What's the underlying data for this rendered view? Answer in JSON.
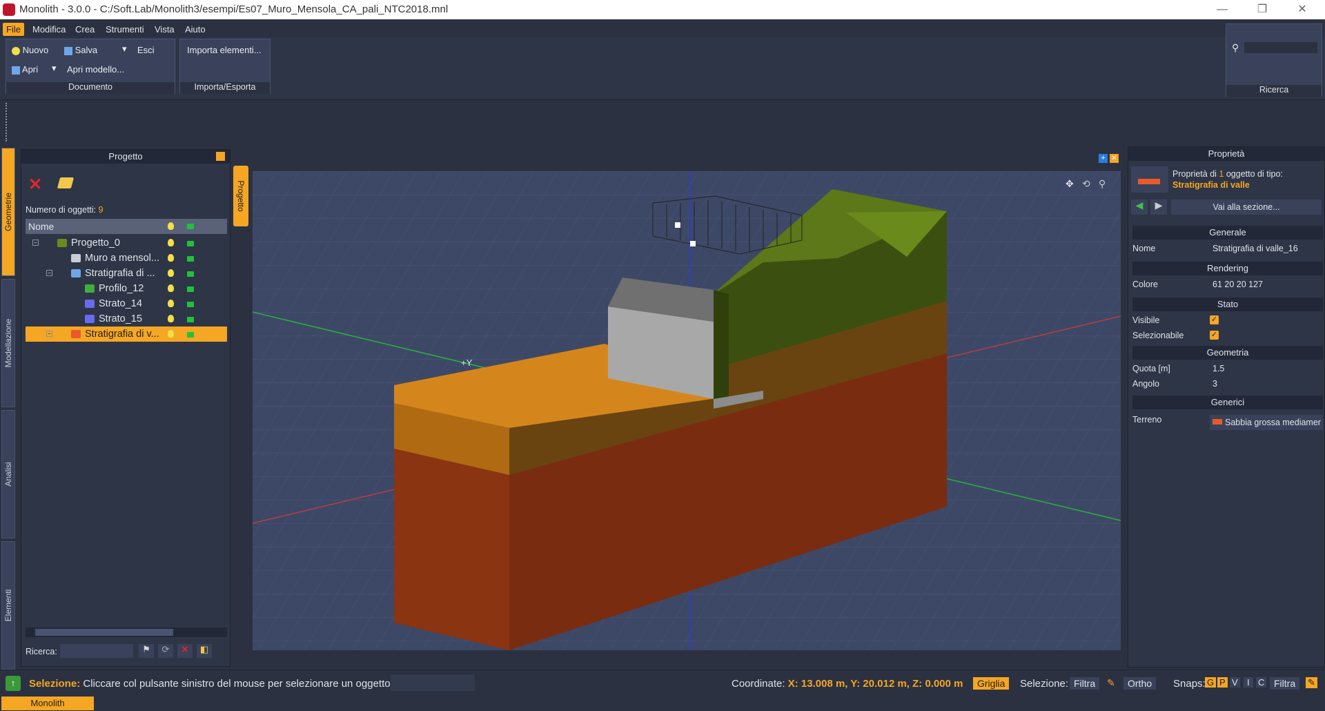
{
  "window": {
    "title": "Monolith - 3.0.0 - C:/Soft.Lab/Monolith3/esempi/Es07_Muro_Mensola_CA_pali_NTC2018.mnl",
    "minimize": "—",
    "maximize": "❐",
    "close": "✕"
  },
  "menu": {
    "items": [
      "File",
      "Modifica",
      "Crea",
      "Strumenti",
      "Vista",
      "Aiuto"
    ]
  },
  "ribbon": {
    "documento": {
      "nuovo": "Nuovo",
      "salva": "Salva",
      "esci": "Esci",
      "apri": "Apri",
      "apri_modello": "Apri modello...",
      "label": "Documento"
    },
    "importa": {
      "importa_elementi": "Importa elementi...",
      "label": "Importa/Esporta"
    },
    "ricerca": {
      "label": "Ricerca"
    }
  },
  "sidetabs": [
    "Geometrie",
    "Modellazione",
    "Analisi",
    "Elementi"
  ],
  "project": {
    "title": "Progetto",
    "tab": "Progetto",
    "count_label": "Numero di oggetti:",
    "count": "9",
    "col_name": "Nome",
    "tree": [
      {
        "label": "Progetto_0",
        "indent": 0
      },
      {
        "label": "Muro a mensol...",
        "indent": 1
      },
      {
        "label": "Stratigrafia di ...",
        "indent": 1
      },
      {
        "label": "Profilo_12",
        "indent": 2
      },
      {
        "label": "Strato_14",
        "indent": 2
      },
      {
        "label": "Strato_15",
        "indent": 2
      },
      {
        "label": "Stratigrafia di v...",
        "indent": 1,
        "selected": true
      }
    ],
    "search_label": "Ricerca:"
  },
  "viewport": {
    "axis_label": "+Y"
  },
  "properties": {
    "title": "Proprietà",
    "header_prefix": "Proprietà di",
    "header_count": "1",
    "header_suffix": "oggetto di tipo:",
    "type": "Stratigrafia di valle",
    "goto": "Vai alla sezione...",
    "sections": {
      "generale": "Generale",
      "rendering": "Rendering",
      "stato": "Stato",
      "geometria": "Geometria",
      "generici": "Generici"
    },
    "nome_label": "Nome",
    "nome_val": "Stratigrafia di valle_16",
    "colore_label": "Colore",
    "colore_val": "61 20 20 127",
    "visibile_label": "Visibile",
    "selezionabile_label": "Selezionabile",
    "quota_label": "Quota [m]",
    "quota_val": "1.5",
    "angolo_label": "Angolo",
    "angolo_val": "3",
    "terreno_label": "Terreno",
    "terreno_val": "Sabbia grossa mediamer"
  },
  "status": {
    "sel_bold": "Selezione:",
    "sel_text": "Cliccare col pulsante sinistro del mouse per selezionare un oggetto",
    "coord_label": "Coordinate:",
    "coord_val": "X: 13.008 m, Y: 20.012 m, Z: 0.000 m",
    "griglia": "Griglia",
    "selezione_label": "Selezione:",
    "filtra": "Filtra",
    "ortho": "Ortho",
    "snaps_label": "Snaps:",
    "snaps": [
      "G",
      "P",
      "V",
      "I",
      "C"
    ],
    "snap_filtra": "Filtra",
    "app_tab": "Monolith"
  },
  "colors": {
    "accent": "#f5a623",
    "terrain_green": "#4a6412",
    "sand": "#e89a2a",
    "clay": "#8a3412"
  }
}
